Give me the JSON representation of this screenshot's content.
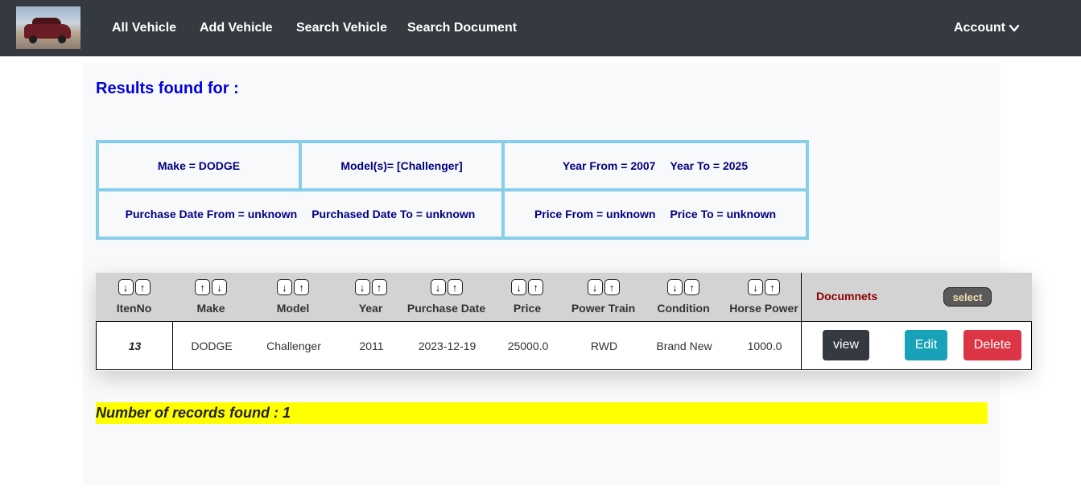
{
  "navbar": {
    "links": [
      "All Vehicle",
      "Add Vehicle",
      "Search Vehicle",
      "Search Document"
    ],
    "account_label": "Account"
  },
  "results_title": "Results found for :",
  "criteria": {
    "make": "Make = DODGE",
    "models": "Model(s)= [Challenger]",
    "year_from": "Year From = 2007",
    "year_to": "Year To = 2025",
    "purchase_from": "Purchase Date From = unknown",
    "purchase_to": "Purchased Date To = unknown",
    "price_from": "Price From = unknown",
    "price_to": "Price To = unknown"
  },
  "table": {
    "columns": [
      {
        "label": "ItenNo",
        "sort": [
          "↓",
          "↑"
        ]
      },
      {
        "label": "Make",
        "sort": [
          "↑",
          "↓"
        ]
      },
      {
        "label": "Model",
        "sort": [
          "↓",
          "↑"
        ]
      },
      {
        "label": "Year",
        "sort": [
          "↓",
          "↑"
        ]
      },
      {
        "label": "Purchase Date",
        "sort": [
          "↓",
          "↑"
        ]
      },
      {
        "label": "Price",
        "sort": [
          "↓",
          "↑"
        ]
      },
      {
        "label": "Power Train",
        "sort": [
          "↓",
          "↑"
        ]
      },
      {
        "label": "Condition",
        "sort": [
          "↓",
          "↑"
        ]
      },
      {
        "label": "Horse Power",
        "sort": [
          "↓",
          "↑"
        ]
      }
    ],
    "documents_label": "Documnets",
    "select_label": "select",
    "rows": [
      {
        "cells": [
          "13",
          "DODGE",
          "Challenger",
          "2011",
          "2023-12-19",
          "25000.0",
          "RWD",
          "Brand New",
          "1000.0"
        ],
        "view_label": "view",
        "edit_label": "Edit",
        "delete_label": "Delete"
      }
    ]
  },
  "records_found": "Number of records found : 1",
  "colors": {
    "navbar": "#343a40",
    "title": "#0000dd",
    "criteria_border": "#87ceeb",
    "criteria_text": "#000080",
    "documents_label": "#8b0000",
    "view_btn": "#343a40",
    "edit_btn": "#17a2b8",
    "delete_btn": "#dc3545",
    "count_bar": "#ffff00"
  }
}
